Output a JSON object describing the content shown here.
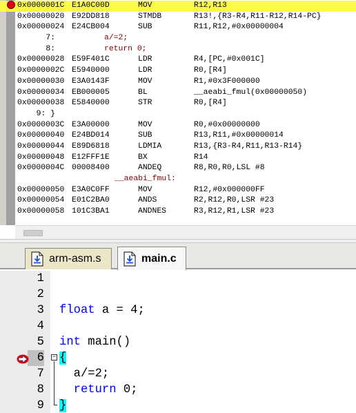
{
  "disassembly": {
    "lines": [
      {
        "kind": "asm",
        "addr": "0x0000001C",
        "code": "E1A0C00D",
        "mnemonic": "MOV",
        "operands": "R12,R13",
        "current": true,
        "breakpoint": true
      },
      {
        "kind": "asm",
        "addr": "0x00000020",
        "code": "E92DD818",
        "mnemonic": "STMDB",
        "operands": "R13!,{R3-R4,R11-R12,R14-PC}"
      },
      {
        "kind": "asm",
        "addr": "0x00000024",
        "code": "E24CB004",
        "mnemonic": "SUB",
        "operands": "R11,R12,#0x00000004"
      },
      {
        "kind": "src",
        "num": "7:",
        "text": "a/=2;"
      },
      {
        "kind": "src",
        "num": "8:",
        "text": "return 0;"
      },
      {
        "kind": "asm",
        "addr": "0x00000028",
        "code": "E59F401C",
        "mnemonic": "LDR",
        "operands": "R4,[PC,#0x001C]"
      },
      {
        "kind": "asm",
        "addr": "0x0000002C",
        "code": "E5940000",
        "mnemonic": "LDR",
        "operands": "R0,[R4]"
      },
      {
        "kind": "asm",
        "addr": "0x00000030",
        "code": "E3A0143F",
        "mnemonic": "MOV",
        "operands": "R1,#0x3F000000"
      },
      {
        "kind": "asm",
        "addr": "0x00000034",
        "code": "EB000005",
        "mnemonic": "BL",
        "operands": "__aeabi_fmul(0x00000050)"
      },
      {
        "kind": "asm",
        "addr": "0x00000038",
        "code": "E5840000",
        "mnemonic": "STR",
        "operands": "R0,[R4]"
      },
      {
        "kind": "src",
        "num": "9: }",
        "text": ""
      },
      {
        "kind": "asm",
        "addr": "0x0000003C",
        "code": "E3A00000",
        "mnemonic": "MOV",
        "operands": "R0,#0x00000000"
      },
      {
        "kind": "asm",
        "addr": "0x00000040",
        "code": "E24BD014",
        "mnemonic": "SUB",
        "operands": "R13,R11,#0x00000014"
      },
      {
        "kind": "asm",
        "addr": "0x00000044",
        "code": "E89D6818",
        "mnemonic": "LDMIA",
        "operands": "R13,{R3-R4,R11,R13-R14}"
      },
      {
        "kind": "asm",
        "addr": "0x00000048",
        "code": "E12FFF1E",
        "mnemonic": "BX",
        "operands": "R14"
      },
      {
        "kind": "asm",
        "addr": "0x0000004C",
        "code": "00008400",
        "mnemonic": "ANDEQ",
        "operands": "R8,R0,R0,LSL #8"
      },
      {
        "kind": "label",
        "text": "__aeabi_fmul:"
      },
      {
        "kind": "asm",
        "addr": "0x00000050",
        "code": "E3A0C0FF",
        "mnemonic": "MOV",
        "operands": "R12,#0x000000FF"
      },
      {
        "kind": "asm",
        "addr": "0x00000054",
        "code": "E01C2BA0",
        "mnemonic": "ANDS",
        "operands": "R2,R12,R0,LSR #23"
      },
      {
        "kind": "asm",
        "addr": "0x00000058",
        "code": "101C3BA1",
        "mnemonic": "ANDNES",
        "operands": "R3,R12,R1,LSR #23"
      }
    ]
  },
  "tabs": [
    {
      "label": "arm-asm.s",
      "active": false
    },
    {
      "label": "main.c",
      "active": true
    }
  ],
  "editor": {
    "lines": [
      {
        "num": "1",
        "tokens": []
      },
      {
        "num": "2",
        "tokens": []
      },
      {
        "num": "3",
        "tokens": [
          {
            "t": "float",
            "c": "kw"
          },
          {
            "t": " a = ",
            "c": ""
          },
          {
            "t": "4",
            "c": "num"
          },
          {
            "t": ";",
            "c": ""
          }
        ]
      },
      {
        "num": "4",
        "tokens": []
      },
      {
        "num": "5",
        "tokens": [
          {
            "t": "int",
            "c": "kw"
          },
          {
            "t": " main()",
            "c": ""
          }
        ]
      },
      {
        "num": "6",
        "tokens": [
          {
            "t": "{",
            "c": "brace"
          }
        ],
        "arrow": true,
        "fold": "open"
      },
      {
        "num": "7",
        "tokens": [
          {
            "t": "  a/=",
            "c": ""
          },
          {
            "t": "2",
            "c": "num"
          },
          {
            "t": ";",
            "c": ""
          }
        ]
      },
      {
        "num": "8",
        "tokens": [
          {
            "t": "  ",
            "c": ""
          },
          {
            "t": "return",
            "c": "kw"
          },
          {
            "t": " ",
            "c": ""
          },
          {
            "t": "0",
            "c": "num"
          },
          {
            "t": ";",
            "c": ""
          }
        ]
      },
      {
        "num": "9",
        "tokens": [
          {
            "t": "}",
            "c": "brace"
          }
        ],
        "fold": "end"
      }
    ]
  },
  "colors": {
    "current_line": "#fbfb44",
    "breakpoint": "#e00000",
    "keyword": "#0000ff",
    "brace_match": "#00ffff",
    "source_in_disasm": "#800000"
  },
  "icons": {
    "tab_file_icon": "file-download-icon",
    "exec_arrow": "current-exec-arrow-icon",
    "breakpoint": "breakpoint-icon"
  }
}
